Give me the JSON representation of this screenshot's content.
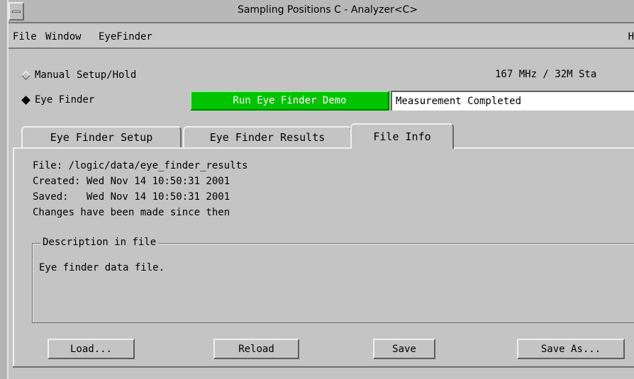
{
  "window": {
    "title": "Sampling Positions C - Analyzer<C>"
  },
  "menubar": {
    "items": [
      "File",
      "Window",
      "EyeFinder"
    ],
    "help": "H"
  },
  "mode": {
    "options": [
      {
        "label": "Manual Setup/Hold",
        "selected": false
      },
      {
        "label": "Eye Finder",
        "selected": true
      }
    ],
    "rate": "167 MHz / 32M Sta"
  },
  "run": {
    "label": "Run Eye Finder Demo",
    "status": "Measurement Completed",
    "accent": "#00c400"
  },
  "tabs": [
    {
      "label": "Eye Finder Setup",
      "active": false
    },
    {
      "label": "Eye Finder Results",
      "active": false
    },
    {
      "label": "File Info",
      "active": true
    }
  ],
  "file_info": {
    "file": "File: /logic/data/eye_finder_results",
    "created": "Created: Wed Nov 14 10:50:31 2001",
    "saved": "Saved:   Wed Nov 14 10:50:31 2001",
    "changes": "Changes have been made since then"
  },
  "description": {
    "title": "Description in file",
    "text": "Eye finder data file."
  },
  "buttons": {
    "load": "Load...",
    "reload": "Reload",
    "save": "Save",
    "save_as": "Save As..."
  }
}
